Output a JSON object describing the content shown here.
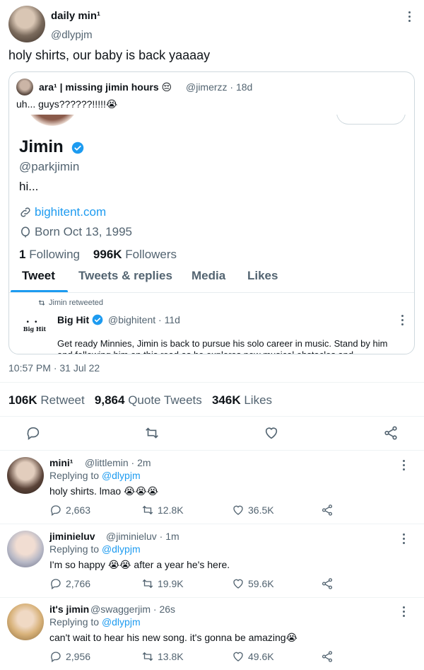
{
  "main_tweet": {
    "author_name": "daily min¹",
    "author_handle": "@dlypjm",
    "text": "holy shirts, our baby is back yaaaay",
    "timestamp": "10:57 PM · 31 Jul 22",
    "retweets_count": "106K",
    "retweets_label": "Retweet",
    "quotes_count": "9,864",
    "quotes_label": "Quote Tweets",
    "likes_count": "346K",
    "likes_label": "Likes"
  },
  "quoted_tweet": {
    "author_name": "ara¹ | missing jimin hours 😔",
    "author_handle": "@jimerzz · 18d",
    "text": "uh... guys??????!!!!!😭"
  },
  "profile": {
    "name": "Jimin",
    "handle": "@parkjimin",
    "bio": "hi...",
    "link": "bighitent.com",
    "born": "Born Oct 13, 1995",
    "following_count": "1",
    "following_label": "Following",
    "followers_count": "996K",
    "followers_label": "Followers",
    "tabs": [
      "Tweet",
      "Tweets & replies",
      "Media",
      "Likes"
    ],
    "retweet_label": "Jimin retweeted",
    "embedded_tweet": {
      "logo_text": "Big Hit",
      "author_name": "Big Hit",
      "author_handle": "@bighitent · 11d",
      "text": "Get ready Minnies, Jimin is back to pursue his solo career in music. Stand by him and following him on this road as he explores new musical obstacles and"
    }
  },
  "replies": [
    {
      "name": "mini¹",
      "handle": "@littlemin · 2m",
      "replying_prefix": "Replying to",
      "replying_to": "@dlypjm",
      "text": "holy shirts. lmao 😭😭😭",
      "replies": "2,663",
      "retweets": "12.8K",
      "likes": "36.5K"
    },
    {
      "name": "jiminieluv",
      "handle": "@jiminieluv · 1m",
      "replying_prefix": "Replying to",
      "replying_to": "@dlypjm",
      "text": "I'm so happy 😭😭 after a year he's here.",
      "replies": "2,766",
      "retweets": "19.9K",
      "likes": "59.6K"
    },
    {
      "name": "it's jimin",
      "handle": "@swaggerjim · 26s",
      "replying_prefix": "Replying to",
      "replying_to": "@dlypjm",
      "text": "can't wait to hear his new song. it's gonna be amazing😭",
      "replies": "2,956",
      "retweets": "13.8K",
      "likes": "49.6K"
    }
  ],
  "colors": {
    "accent": "#1d9bf0",
    "secondary_text": "#536471",
    "border": "#cfd9de"
  },
  "icons": [
    "more-icon",
    "verified-badge-icon",
    "link-icon",
    "birthday-icon",
    "retweet-icon",
    "reply-icon",
    "like-icon",
    "share-icon"
  ]
}
